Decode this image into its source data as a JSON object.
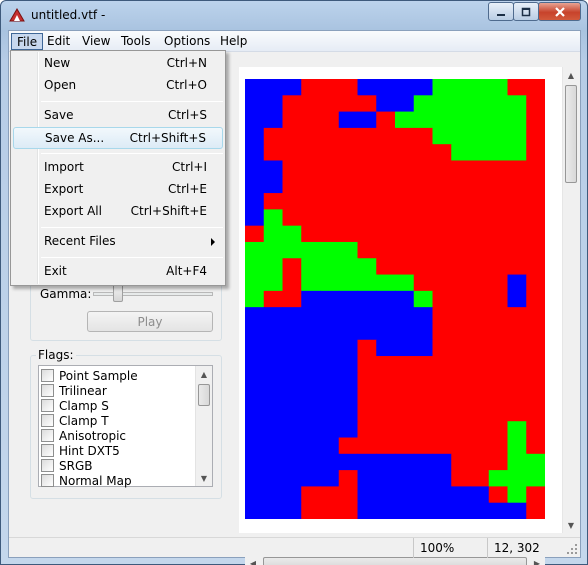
{
  "window": {
    "title": "untitled.vtf -"
  },
  "menubar": [
    "File",
    "Edit",
    "View",
    "Tools",
    "Options",
    "Help"
  ],
  "file_menu": [
    {
      "label": "New",
      "shortcut": "Ctrl+N"
    },
    {
      "label": "Open",
      "shortcut": "Ctrl+O"
    },
    {
      "label": "Save",
      "shortcut": "Ctrl+S"
    },
    {
      "label": "Save As...",
      "shortcut": "Ctrl+Shift+S",
      "highlighted": true
    },
    {
      "label": "Import",
      "shortcut": "Ctrl+I"
    },
    {
      "label": "Export",
      "shortcut": "Ctrl+E"
    },
    {
      "label": "Export All",
      "shortcut": "Ctrl+Shift+E"
    },
    {
      "label": "Recent Files",
      "shortcut": ""
    },
    {
      "label": "Exit",
      "shortcut": "Alt+F4"
    }
  ],
  "left_panel": {
    "gamma_label": "Gamma:",
    "play_label": "Play",
    "flags_label": "Flags:",
    "flags": [
      "Point Sample",
      "Trilinear",
      "Clamp S",
      "Clamp T",
      "Anisotropic",
      "Hint DXT5",
      "SRGB",
      "Normal Map"
    ]
  },
  "status": {
    "zoom": "100%",
    "coords": "12, 302"
  },
  "texture": {
    "palette": {
      "R": "#ff0000",
      "G": "#00ff00",
      "B": "#0000ff"
    },
    "grid": [
      "BBBRRRBBBBGGGGRR",
      "BBRRRRRBBGGGGGGR",
      "BBRRRBBRGGGGGGGR",
      "BRRRRRRRRRGGGGGR",
      "BRRRRRRRRRRGGGGR",
      "BBRRRRRRRRRRRRRR",
      "BBRRRRRRRRRRRRRR",
      "BRRRRRRRRRRRRRRR",
      "BGRRRRRRRRRRRRRR",
      "RGGRRRRRRRRRRRRR",
      "GGGGGGRRRRRRRRRR",
      "GGRGGGGRRRRRRRRR",
      "GGRGGGGGGRRRRRBR",
      "GRRBBBBBBGRRRRBR",
      "BBBBBBBBBBRRRRRR",
      "BBBBBBBBBBRRRRRR",
      "BBBBBBRBBBRRRRRR",
      "BBBBBBRRRRRRRRRR",
      "BBBBBBRRRRRRRRRR",
      "BBBBBBRRRRRRRRRR",
      "BBBBBBRRRRRRRRRR",
      "BBBBBBRRRRRRRRGR",
      "BBBBBRRRRRRRRRGR",
      "BBBBBBBBBBBRRRGG",
      "BBBBBRBBBBBRRGGG",
      "BBBRRRBBBBBBBRGR",
      "BBBRRRBBBBBBBBBR"
    ]
  }
}
